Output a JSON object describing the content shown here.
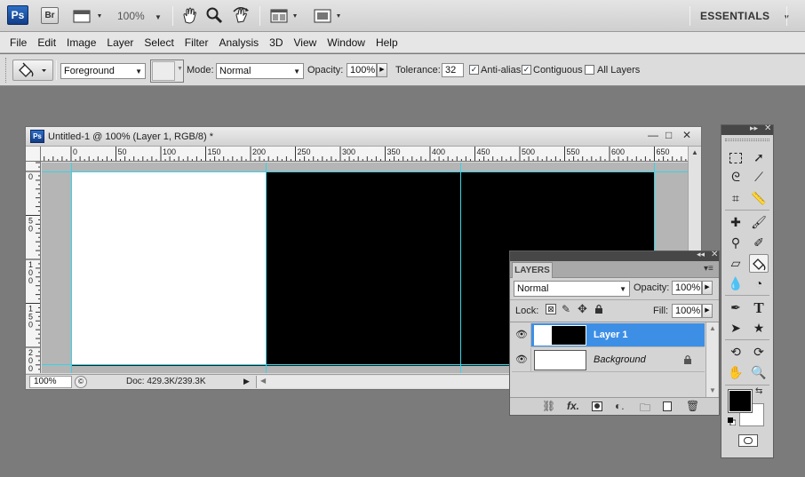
{
  "appbar": {
    "ps_logo": "Ps",
    "br_logo": "Br",
    "zoom": "100%",
    "workspace": "ESSENTIALS"
  },
  "menu": [
    "File",
    "Edit",
    "Image",
    "Layer",
    "Select",
    "Filter",
    "Analysis",
    "3D",
    "View",
    "Window",
    "Help"
  ],
  "options": {
    "fill_source": "Foreground",
    "mode_label": "Mode:",
    "mode_value": "Normal",
    "opacity_label": "Opacity:",
    "opacity_value": "100%",
    "tolerance_label": "Tolerance:",
    "tolerance_value": "32",
    "antialias_label": "Anti-alias",
    "contiguous_label": "Contiguous",
    "alllayers_label": "All Layers"
  },
  "document": {
    "title": "Untitled-1 @ 100% (Layer 1, RGB/8) *",
    "ps_mini": "Ps",
    "zoom": "100%",
    "doc_info": "Doc: 429.3K/239.3K",
    "h_ruler_ticks": [
      "0",
      "50",
      "100",
      "150",
      "200",
      "250",
      "300",
      "350",
      "400",
      "450",
      "500",
      "550",
      "600",
      "650"
    ],
    "v_ruler_ticks": [
      "0",
      "5\n0",
      "1\n0\n0",
      "1\n5\n0",
      "2\n0\n0"
    ]
  },
  "layers_panel": {
    "tab": "LAYERS",
    "blend_mode": "Normal",
    "opacity_label": "Opacity:",
    "opacity_value": "100%",
    "lock_label": "Lock:",
    "fill_label": "Fill:",
    "fill_value": "100%",
    "layers": [
      {
        "name": "Layer 1",
        "selected": true
      },
      {
        "name": "Background",
        "selected": false,
        "locked": true
      }
    ],
    "selection_color": "#3d8fe6"
  },
  "colors": {
    "foreground": "#000000",
    "background": "#ffffff",
    "guide": "#36d4e8",
    "workspace": "#7b7b7b"
  },
  "tools": [
    "rectangular-marquee",
    "move",
    "lasso",
    "magic-wand",
    "crop",
    "ruler",
    "healing-brush",
    "brush",
    "clone-stamp",
    "history-brush",
    "eraser",
    "paint-bucket",
    "blur",
    "dodge",
    "pen",
    "type",
    "path-selection",
    "custom-shape",
    "3d-rotate",
    "3d-orbit",
    "hand",
    "zoom"
  ]
}
